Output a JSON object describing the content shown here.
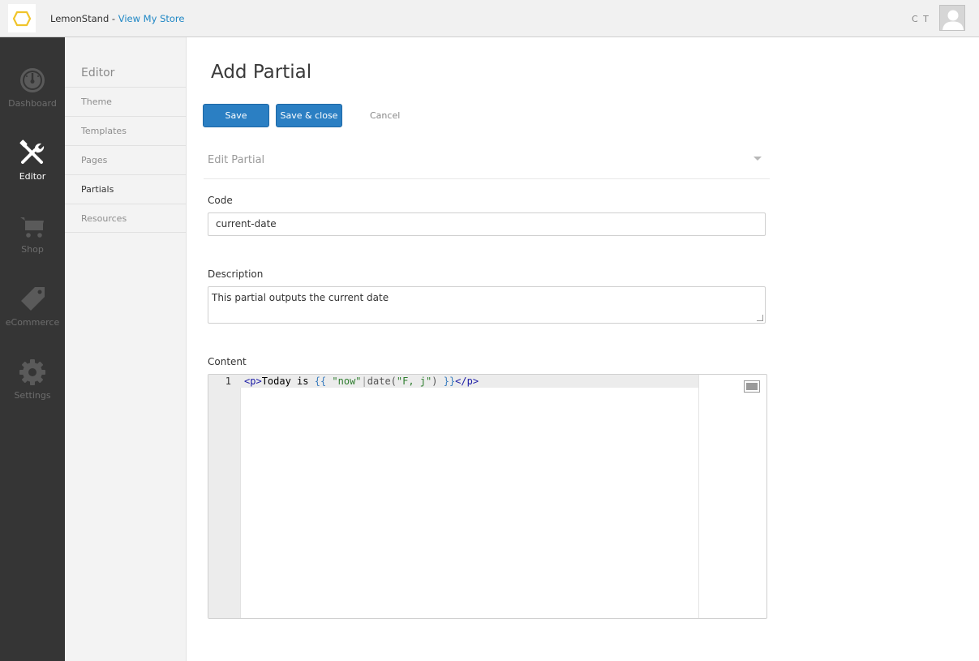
{
  "topbar": {
    "brand_name": "LemonStand",
    "brand_separator": " - ",
    "view_store_label": "View My Store",
    "user_initials": "C T",
    "accent_color": "#1f87c5",
    "logo_color": "#f0c42a"
  },
  "leftnav": {
    "items": [
      {
        "label": "Dashboard",
        "icon": "dashboard-gauge-icon",
        "active": false
      },
      {
        "label": "Editor",
        "icon": "editor-tools-icon",
        "active": true
      },
      {
        "label": "Shop",
        "icon": "shopping-cart-icon",
        "active": false
      },
      {
        "label": "eCommerce",
        "icon": "price-tag-icon",
        "active": false
      },
      {
        "label": "Settings",
        "icon": "gear-icon",
        "active": false
      }
    ]
  },
  "subnav": {
    "title": "Editor",
    "items": [
      {
        "label": "Theme",
        "active": false
      },
      {
        "label": "Templates",
        "active": false
      },
      {
        "label": "Pages",
        "active": false
      },
      {
        "label": "Partials",
        "active": true
      },
      {
        "label": "Resources",
        "active": false
      }
    ]
  },
  "main": {
    "page_title": "Add Partial",
    "save_label": "Save",
    "save_close_label": "Save & close",
    "cancel_label": "Cancel",
    "section_title": "Edit Partial",
    "fields": {
      "code_label": "Code",
      "code_value": "current-date",
      "description_label": "Description",
      "description_value": "This partial outputs the current date",
      "content_label": "Content"
    },
    "editor": {
      "line_number": "1",
      "tokens": {
        "open_tag": "<p>",
        "text": "Today is ",
        "open_brace": "{{",
        "space1": " ",
        "str_now": "\"now\"",
        "pipe": "|",
        "fn": "date(",
        "str_fmt": "\"F, j\"",
        "close_paren": ")",
        "space2": " ",
        "close_brace": "}}",
        "close_tag": "</p>"
      }
    },
    "button_color": "#2b7fc3"
  }
}
